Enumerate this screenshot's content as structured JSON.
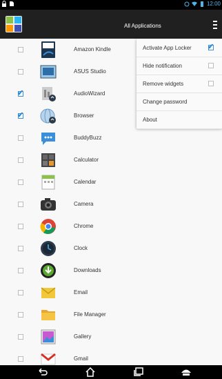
{
  "status_bar": {
    "time": "12:00"
  },
  "action_bar": {
    "title": "All Applications"
  },
  "apps": [
    {
      "name": "Amazon Kindle",
      "checked": false,
      "icon": "kindle-icon"
    },
    {
      "name": "ASUS Studio",
      "checked": false,
      "icon": "asus-studio-icon"
    },
    {
      "name": "AudioWizard",
      "checked": true,
      "icon": "audiowizard-icon"
    },
    {
      "name": "Browser",
      "checked": true,
      "icon": "browser-icon"
    },
    {
      "name": "BuddyBuzz",
      "checked": false,
      "icon": "buddybuzz-icon"
    },
    {
      "name": "Calculator",
      "checked": false,
      "icon": "calculator-icon"
    },
    {
      "name": "Calendar",
      "checked": false,
      "icon": "calendar-icon"
    },
    {
      "name": "Camera",
      "checked": false,
      "icon": "camera-icon"
    },
    {
      "name": "Chrome",
      "checked": false,
      "icon": "chrome-icon"
    },
    {
      "name": "Clock",
      "checked": false,
      "icon": "clock-icon"
    },
    {
      "name": "Downloads",
      "checked": false,
      "icon": "downloads-icon"
    },
    {
      "name": "Email",
      "checked": false,
      "icon": "email-icon"
    },
    {
      "name": "File Manager",
      "checked": false,
      "icon": "file-manager-icon"
    },
    {
      "name": "Gallery",
      "checked": false,
      "icon": "gallery-icon"
    },
    {
      "name": "Gmail",
      "checked": false,
      "icon": "gmail-icon"
    }
  ],
  "menu": {
    "items": [
      {
        "label": "Activate App Locker",
        "checkbox": true,
        "checked": true
      },
      {
        "label": "Hide notification",
        "checkbox": true,
        "checked": false
      },
      {
        "label": "Remove widgets",
        "checkbox": true,
        "checked": false
      },
      {
        "label": "Change password",
        "checkbox": false
      },
      {
        "label": "About",
        "checkbox": false
      }
    ]
  },
  "colors": {
    "accent": "#2e89d6",
    "status_time": "#4fb4e8"
  }
}
